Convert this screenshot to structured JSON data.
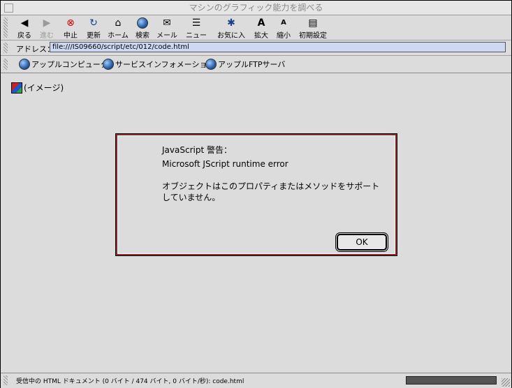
{
  "window": {
    "title": "マシンのグラフィック能力を調べる"
  },
  "toolbar": {
    "buttons": [
      {
        "label": "戻る",
        "icon": "back-arrow-icon"
      },
      {
        "label": "進む",
        "icon": "forward-arrow-icon"
      },
      {
        "label": "中止",
        "icon": "stop-icon"
      },
      {
        "label": "更新",
        "icon": "refresh-icon"
      },
      {
        "label": "ホーム",
        "icon": "home-icon"
      },
      {
        "label": "検索",
        "icon": "search-globe-icon"
      },
      {
        "label": "メール",
        "icon": "mail-icon"
      },
      {
        "label": "ニュース",
        "icon": "news-icon"
      },
      {
        "label": "お気に入り",
        "icon": "favorites-icon"
      },
      {
        "label": "拡大",
        "icon": "enlarge-font-icon"
      },
      {
        "label": "縮小",
        "icon": "shrink-font-icon"
      },
      {
        "label": "初期設定",
        "icon": "preferences-icon"
      }
    ]
  },
  "address": {
    "label": "アドレス：",
    "value": "file:///IS09660/script/etc/012/code.html"
  },
  "favorites": [
    {
      "label": "アップルコンピュータ"
    },
    {
      "label": "サービスインフォメーション"
    },
    {
      "label": "アップルFTPサーバ"
    }
  ],
  "content": {
    "image_placeholder": "(イメージ)"
  },
  "dialog": {
    "title": "JavaScript 警告：",
    "error": "Microsoft JScript runtime error",
    "message": "オブジェクトはこのプロパティまたはメソッドをサポートしていません。",
    "ok_label": "OK"
  },
  "status": {
    "text": "受信中の HTML ドキュメント (0 バイト / 474 バイト, 0 バイト/秒): code.html"
  },
  "colors": {
    "dialog_border": "#8b2a2a",
    "address_bg": "#cfd8f2"
  }
}
